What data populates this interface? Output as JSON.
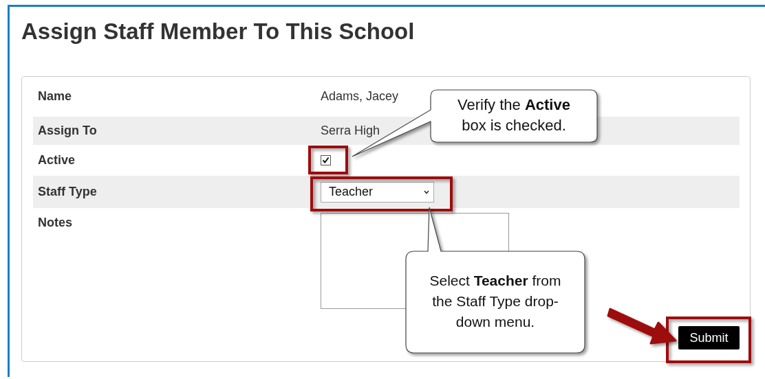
{
  "title": "Assign Staff Member To This School",
  "fields": [
    {
      "label": "Name",
      "kind": "text",
      "value": "Adams, Jacey"
    },
    {
      "label": "Assign To",
      "kind": "text",
      "value": "Serra High"
    },
    {
      "label": "Active",
      "kind": "checkbox",
      "checked": true
    },
    {
      "label": "Staff Type",
      "kind": "select",
      "value": "Teacher"
    },
    {
      "label": "Notes",
      "kind": "textarea"
    }
  ],
  "submit_button": "Submit",
  "callouts": [
    {
      "text": "Verify the **Active** box is checked."
    },
    {
      "text": "Select **Teacher** from the Staff Type drop-down menu."
    }
  ]
}
